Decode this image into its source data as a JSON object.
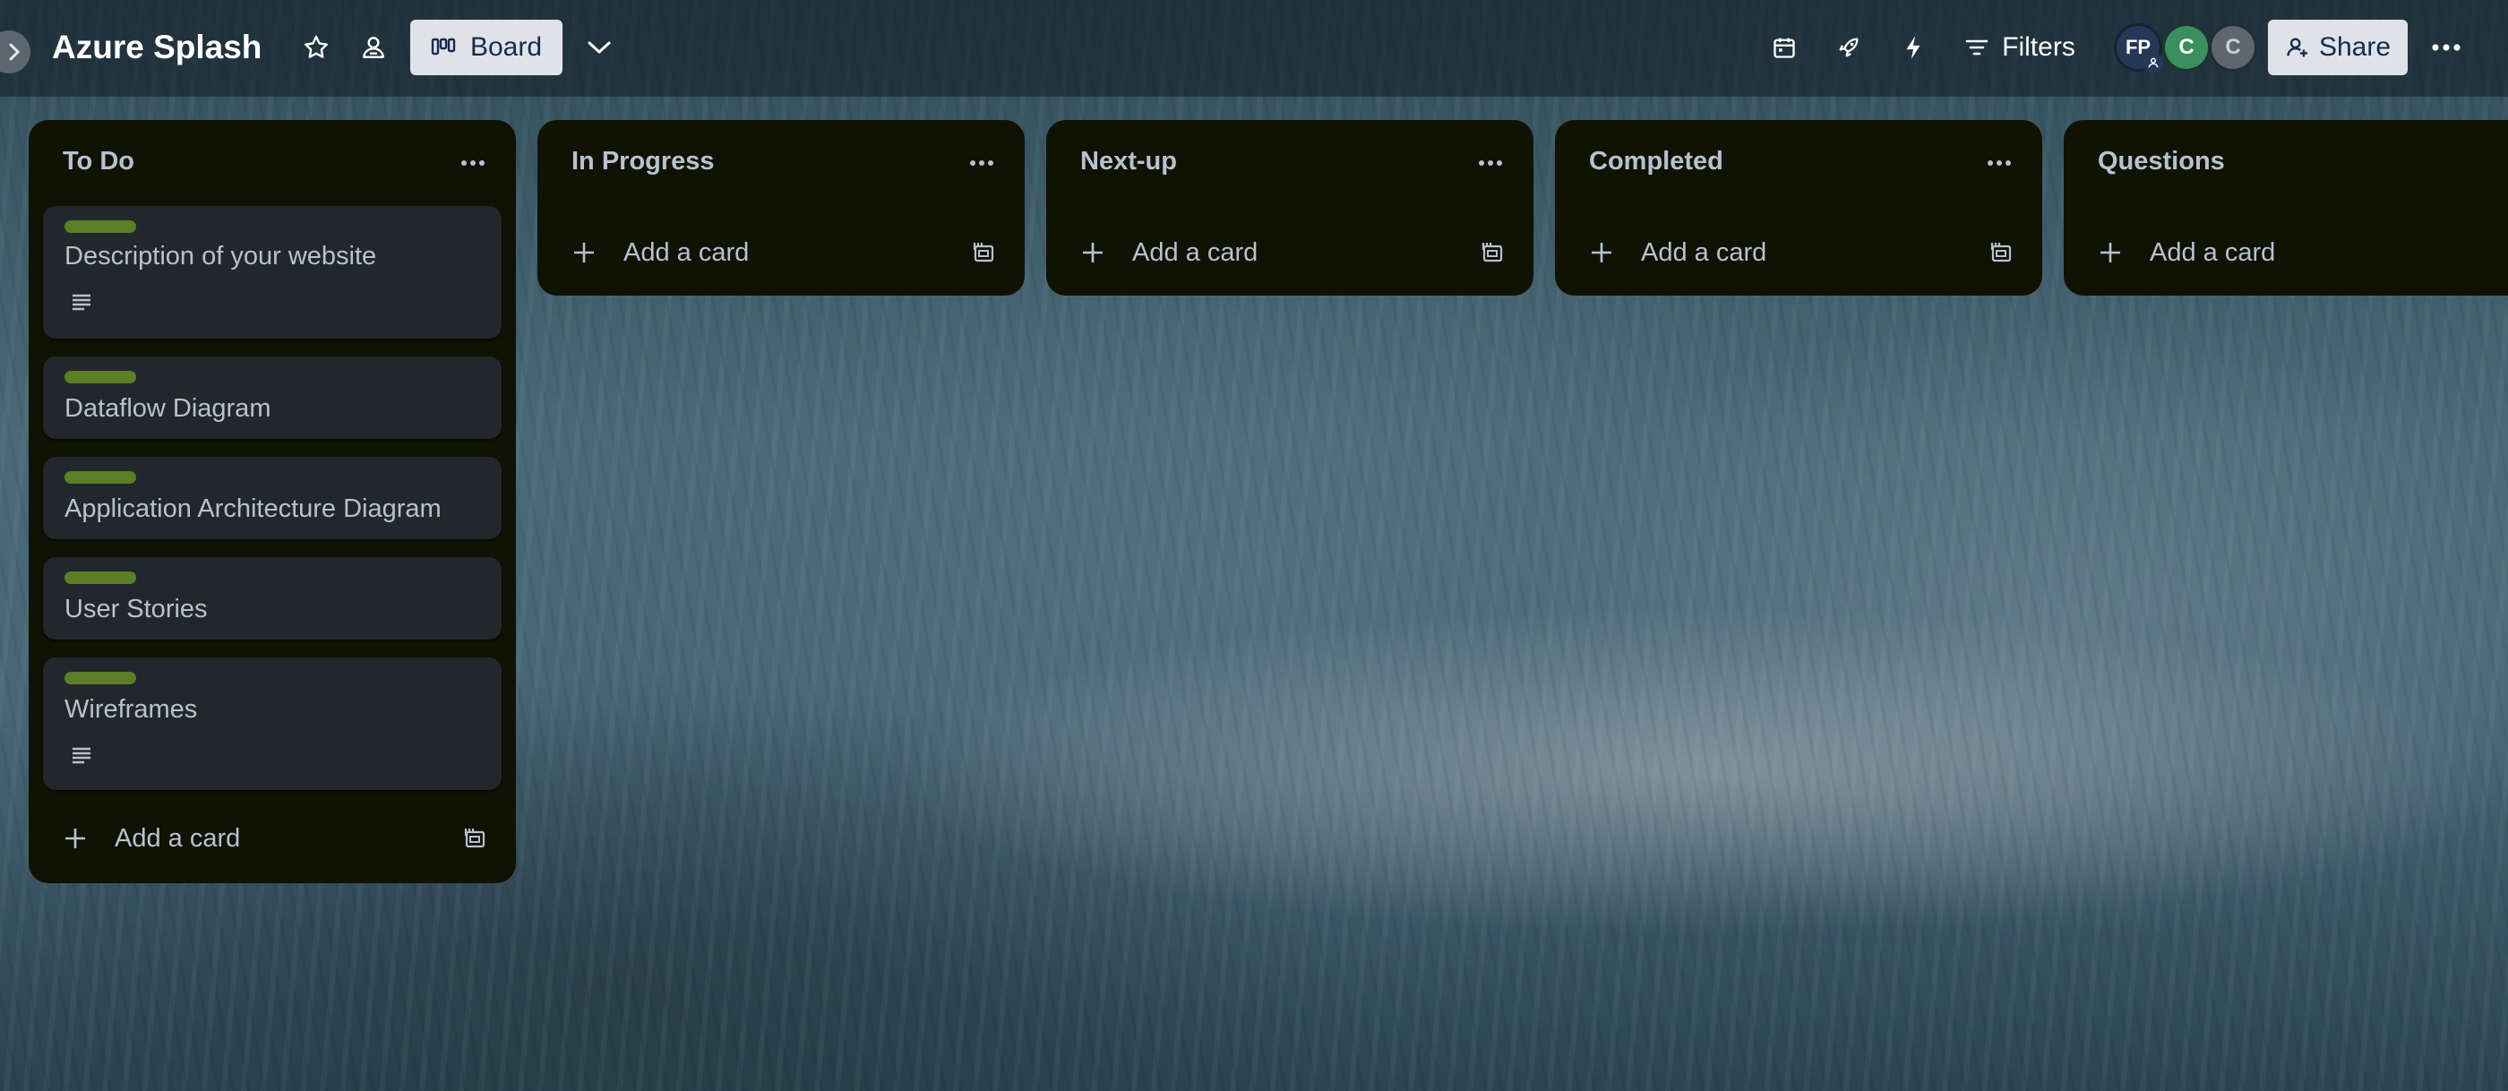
{
  "board": {
    "title": "Azure Splash",
    "view_label": "Board",
    "filters_label": "Filters",
    "share_label": "Share",
    "members": [
      {
        "initials": "FP",
        "color": "#253858"
      },
      {
        "initials": "C",
        "color": "#3b8f5c"
      },
      {
        "initials": "C",
        "color": "#5e6670"
      }
    ]
  },
  "lists": [
    {
      "title": "To Do",
      "cards": [
        {
          "title": "Description of your website",
          "label_color": "#5b7f24",
          "has_description": true
        },
        {
          "title": "Dataflow Diagram",
          "label_color": "#5b7f24",
          "has_description": false
        },
        {
          "title": "Application Architecture Diagram",
          "label_color": "#5b7f24",
          "has_description": false
        },
        {
          "title": "User Stories",
          "label_color": "#5b7f24",
          "has_description": false
        },
        {
          "title": "Wireframes",
          "label_color": "#5b7f24",
          "has_description": true
        }
      ],
      "add_card_label": "Add a card"
    },
    {
      "title": "In Progress",
      "cards": [],
      "add_card_label": "Add a card"
    },
    {
      "title": "Next-up",
      "cards": [],
      "add_card_label": "Add a card"
    },
    {
      "title": "Completed",
      "cards": [],
      "add_card_label": "Add a card"
    },
    {
      "title": "Questions",
      "cards": [],
      "add_card_label": "Add a card"
    }
  ],
  "icons": [
    "chevron-right-icon",
    "star-icon",
    "workspace-visibility-icon",
    "board-icon",
    "chevron-down-icon",
    "calendar-icon",
    "rocket-icon",
    "bolt-icon",
    "filter-icon",
    "add-member-icon",
    "more-icon",
    "plus-icon",
    "card-template-icon",
    "description-icon"
  ],
  "colors": {
    "list_bg": "#101204",
    "card_bg": "#22272b",
    "label_green": "#5b7f24",
    "text": "#b6c2cf"
  }
}
